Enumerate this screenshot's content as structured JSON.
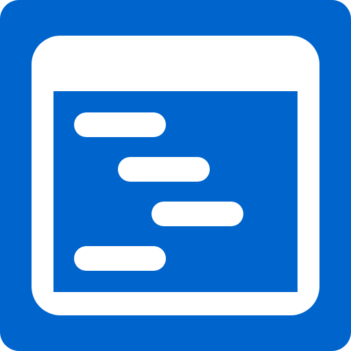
{
  "icon": {
    "name": "gantt-chart-app-icon",
    "colors": {
      "background": "#0064CD",
      "foreground": "#FFFFFF"
    }
  }
}
